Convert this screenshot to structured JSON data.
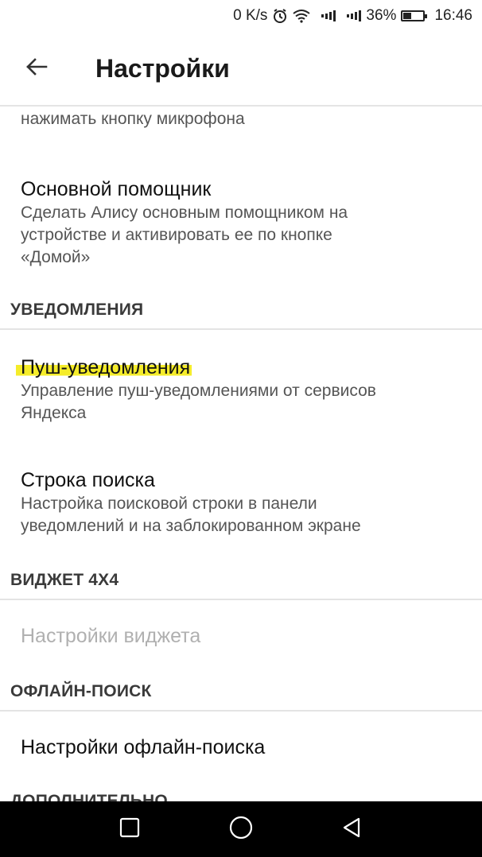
{
  "status_bar": {
    "speed": "0 K/s",
    "battery_pct": "36%",
    "battery_level": 0.36,
    "time": "16:46"
  },
  "toolbar": {
    "title": "Настройки"
  },
  "items": {
    "partial_summary": "нажимать кнопку микрофона",
    "assistant_title": "Основной помощник",
    "assistant_summary_1": "Сделать Алису основным помощником на",
    "assistant_summary_2": "устройстве и активировать ее по кнопке",
    "assistant_summary_3": "«Домой»",
    "push_title": "Пуш-уведомления",
    "push_summary_1": "Управление пуш-уведомлениями от сервисов",
    "push_summary_2": "Яндекса",
    "search_bar_title": "Строка поиска",
    "search_bar_summary_1": "Настройка поисковой строки в панели",
    "search_bar_summary_2": "уведомлений и на заблокированном экране",
    "widget_settings_title": "Настройки виджета",
    "offline_settings_title": "Настройки офлайн-поиска"
  },
  "sections": {
    "notifications": "УВЕДОМЛЕНИЯ",
    "widget": "ВИДЖЕТ 4X4",
    "offline": "ОФЛАЙН-ПОИСК",
    "more": "ДОПОЛНИТЕЛЬНО"
  },
  "icons": {
    "back": "arrow-back-icon",
    "alarm": "alarm-icon",
    "wifi": "wifi-icon",
    "signal": "signal-icon",
    "battery": "battery-icon",
    "nav_recent": "square-icon",
    "nav_home": "circle-icon",
    "nav_back": "triangle-back-icon"
  },
  "colors": {
    "highlight": "#f5ec2a",
    "divider": "#e4e4e4",
    "disabled_text": "#b0b0b0"
  }
}
